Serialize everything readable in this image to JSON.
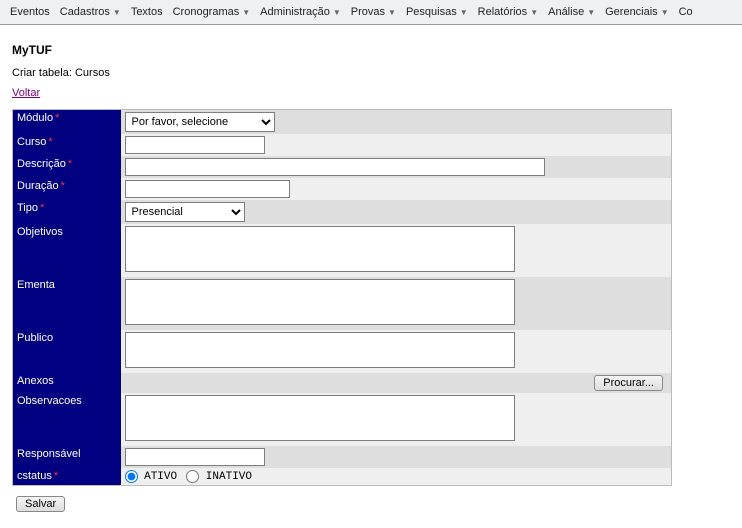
{
  "menubar": {
    "items": [
      {
        "label": "Eventos",
        "dropdown": false
      },
      {
        "label": "Cadastros",
        "dropdown": true
      },
      {
        "label": "Textos",
        "dropdown": false
      },
      {
        "label": "Cronogramas",
        "dropdown": true
      },
      {
        "label": "Administração",
        "dropdown": true
      },
      {
        "label": "Provas",
        "dropdown": true
      },
      {
        "label": "Pesquisas",
        "dropdown": true
      },
      {
        "label": "Relatórios",
        "dropdown": true
      },
      {
        "label": "Análise",
        "dropdown": true
      },
      {
        "label": "Gerenciais",
        "dropdown": true
      },
      {
        "label": "Co",
        "dropdown": false
      }
    ]
  },
  "header": {
    "app_title": "MyTUF",
    "subtitle": "Criar tabela: Cursos",
    "back_link": "Voltar"
  },
  "form": {
    "modulo_label": "Módulo",
    "modulo_value": "Por favor, selecione",
    "curso_label": "Curso",
    "curso_value": "",
    "descricao_label": "Descrição",
    "descricao_value": "",
    "duracao_label": "Duração",
    "duracao_value": "",
    "tipo_label": "Tipo",
    "tipo_value": "Presencial",
    "objetivos_label": "Objetivos",
    "objetivos_value": "",
    "ementa_label": "Ementa",
    "ementa_value": "",
    "publico_label": "Publico",
    "publico_value": "",
    "anexos_label": "Anexos",
    "browse_label": "Procurar...",
    "observacoes_label": "Observacoes",
    "observacoes_value": "",
    "responsavel_label": "Responsável",
    "responsavel_value": "",
    "cstatus_label": "cstatus",
    "cstatus_options": {
      "ativo": "ATIVO",
      "inativo": "INATIVO"
    },
    "cstatus_selected": "ativo"
  },
  "buttons": {
    "save": "Salvar"
  }
}
